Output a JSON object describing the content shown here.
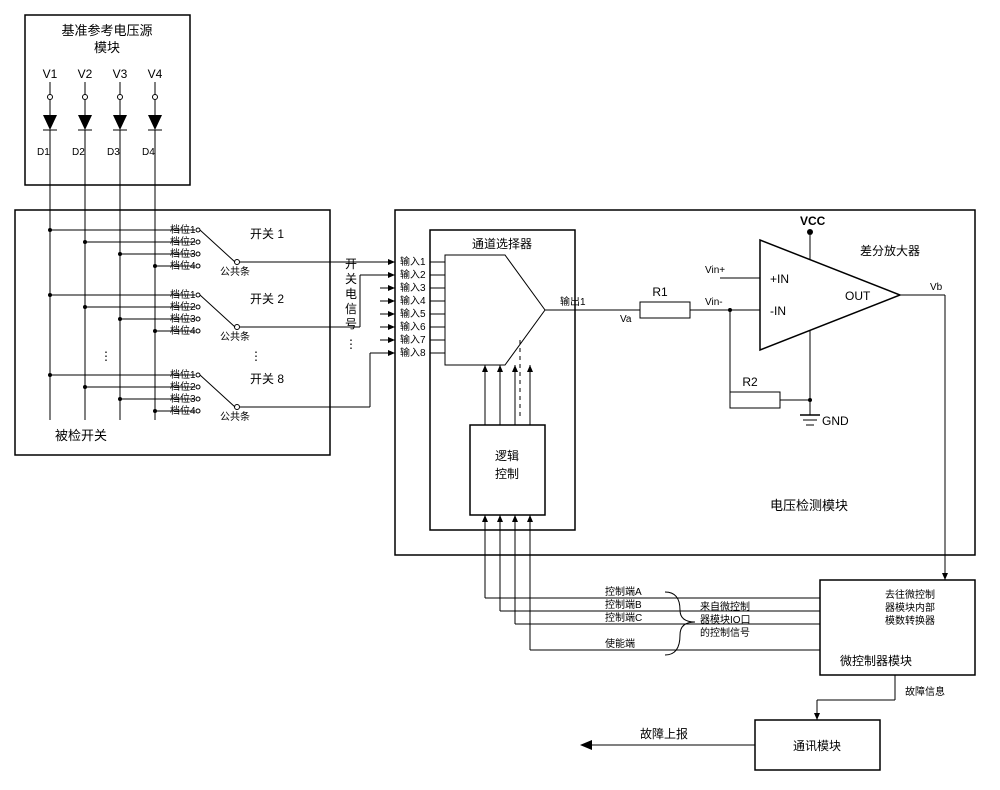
{
  "ref_module": {
    "title_l1": "基准参考电压源",
    "title_l2": "模块",
    "v_labels": [
      "V1",
      "V2",
      "V3",
      "V4"
    ],
    "d_labels": [
      "D1",
      "D2",
      "D3",
      "D4"
    ]
  },
  "switch_box": {
    "title": "被检开关",
    "pos_labels": [
      "档位1",
      "档位2",
      "档位3",
      "档位4"
    ],
    "common": "公共条",
    "sw_labels": [
      "开关 1",
      "开关 2",
      "开关 8"
    ],
    "vertical_label": "开关电信号",
    "ellipsis": "⋮"
  },
  "selector": {
    "title": "通道选择器",
    "inputs": [
      "输入1",
      "输入2",
      "输入3",
      "输入4",
      "输入5",
      "输入6",
      "输入7",
      "输入8"
    ],
    "output": "输出1",
    "logic_l1": "逻辑",
    "logic_l2": "控制"
  },
  "amp": {
    "title": "差分放大器",
    "vcc": "VCC",
    "gnd": "GND",
    "plus": "+IN",
    "minus": "-IN",
    "out": "OUT",
    "vin_plus": "Vin+",
    "vin_minus": "Vin-",
    "va": "Va",
    "vb": "Vb",
    "r1": "R1",
    "r2": "R2"
  },
  "detection_box": "电压检测模块",
  "mcu": {
    "title": "微控制器模块",
    "ctrl_a": "控制端A",
    "ctrl_b": "控制端B",
    "ctrl_c": "控制端C",
    "enable": "使能端",
    "note_l1": "来自微控制",
    "note_l2": "器模块IO口",
    "note_l3": "的控制信号",
    "adc_l1": "去往微控制",
    "adc_l2": "器模块内部",
    "adc_l3": "模数转换器",
    "fault_info": "故障信息"
  },
  "comm": {
    "title": "通讯模块",
    "report": "故障上报"
  }
}
